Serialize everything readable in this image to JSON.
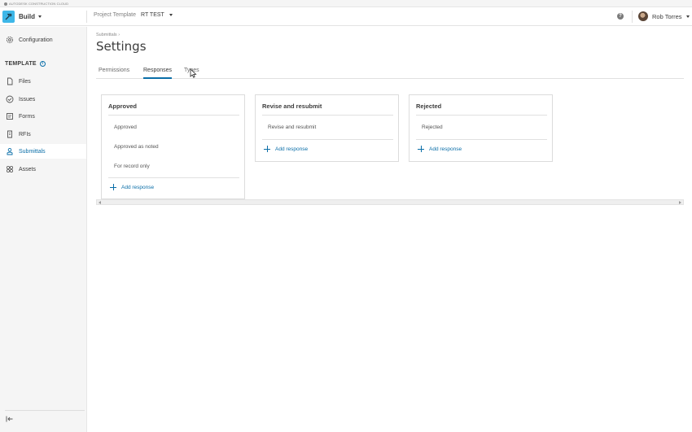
{
  "top_strip": {
    "text": "AUTODESK CONSTRUCTION CLOUD"
  },
  "header": {
    "module_label": "Build",
    "project_label": "Project Template",
    "project_value": "RT TEST",
    "help_glyph": "?",
    "user_name": "Rob Torres"
  },
  "sidebar": {
    "configuration": "Configuration",
    "template_label": "TEMPLATE",
    "info_glyph": "i",
    "items": [
      {
        "label": "Files",
        "icon": "file-icon"
      },
      {
        "label": "Issues",
        "icon": "check-circle-icon"
      },
      {
        "label": "Forms",
        "icon": "form-icon"
      },
      {
        "label": "RFIs",
        "icon": "document-icon"
      },
      {
        "label": "Submittals",
        "icon": "submittals-icon",
        "active": true
      },
      {
        "label": "Assets",
        "icon": "assets-icon"
      }
    ]
  },
  "main": {
    "breadcrumb": "Submittals ›",
    "title": "Settings",
    "tabs": [
      {
        "label": "Permissions"
      },
      {
        "label": "Responses",
        "active": true
      },
      {
        "label": "Types"
      }
    ],
    "cards": [
      {
        "title": "Approved",
        "responses": [
          "Approved",
          "Approved as noted",
          "For record only"
        ],
        "add_label": "Add response"
      },
      {
        "title": "Revise and resubmit",
        "responses": [
          "Revise and resubmit"
        ],
        "add_label": "Add response"
      },
      {
        "title": "Rejected",
        "responses": [
          "Rejected"
        ],
        "add_label": "Add response"
      }
    ]
  },
  "colors": {
    "accent": "#0a6ea8",
    "build_icon_bg": "#3db7e8",
    "sidebar_bg": "#f5f5f5"
  }
}
